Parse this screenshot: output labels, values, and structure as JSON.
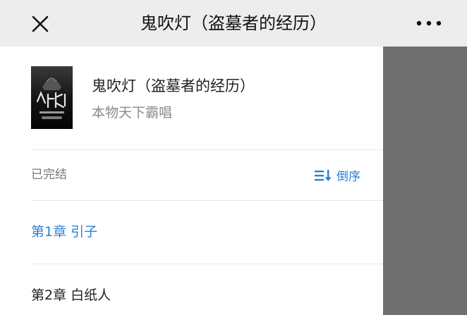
{
  "header": {
    "title": "鬼吹灯（盗墓者的经历）"
  },
  "book": {
    "title": "鬼吹灯（盗墓者的经历）",
    "author": "本物天下霸唱"
  },
  "catalog": {
    "status": "已完结",
    "sort_label": "倒序"
  },
  "chapters": [
    {
      "label": "第1章 引子",
      "color": "#2b7fd6"
    },
    {
      "label": "第2章 白纸人",
      "color": "#222222"
    }
  ],
  "colors": {
    "header_bg": "#ededed",
    "accent": "#2b7fd6",
    "overlay": "#6f6f6f"
  },
  "icons": {
    "close": "close-icon",
    "more": "more-icon",
    "sort": "sort-descending-icon",
    "cover": "book-cover-image"
  }
}
